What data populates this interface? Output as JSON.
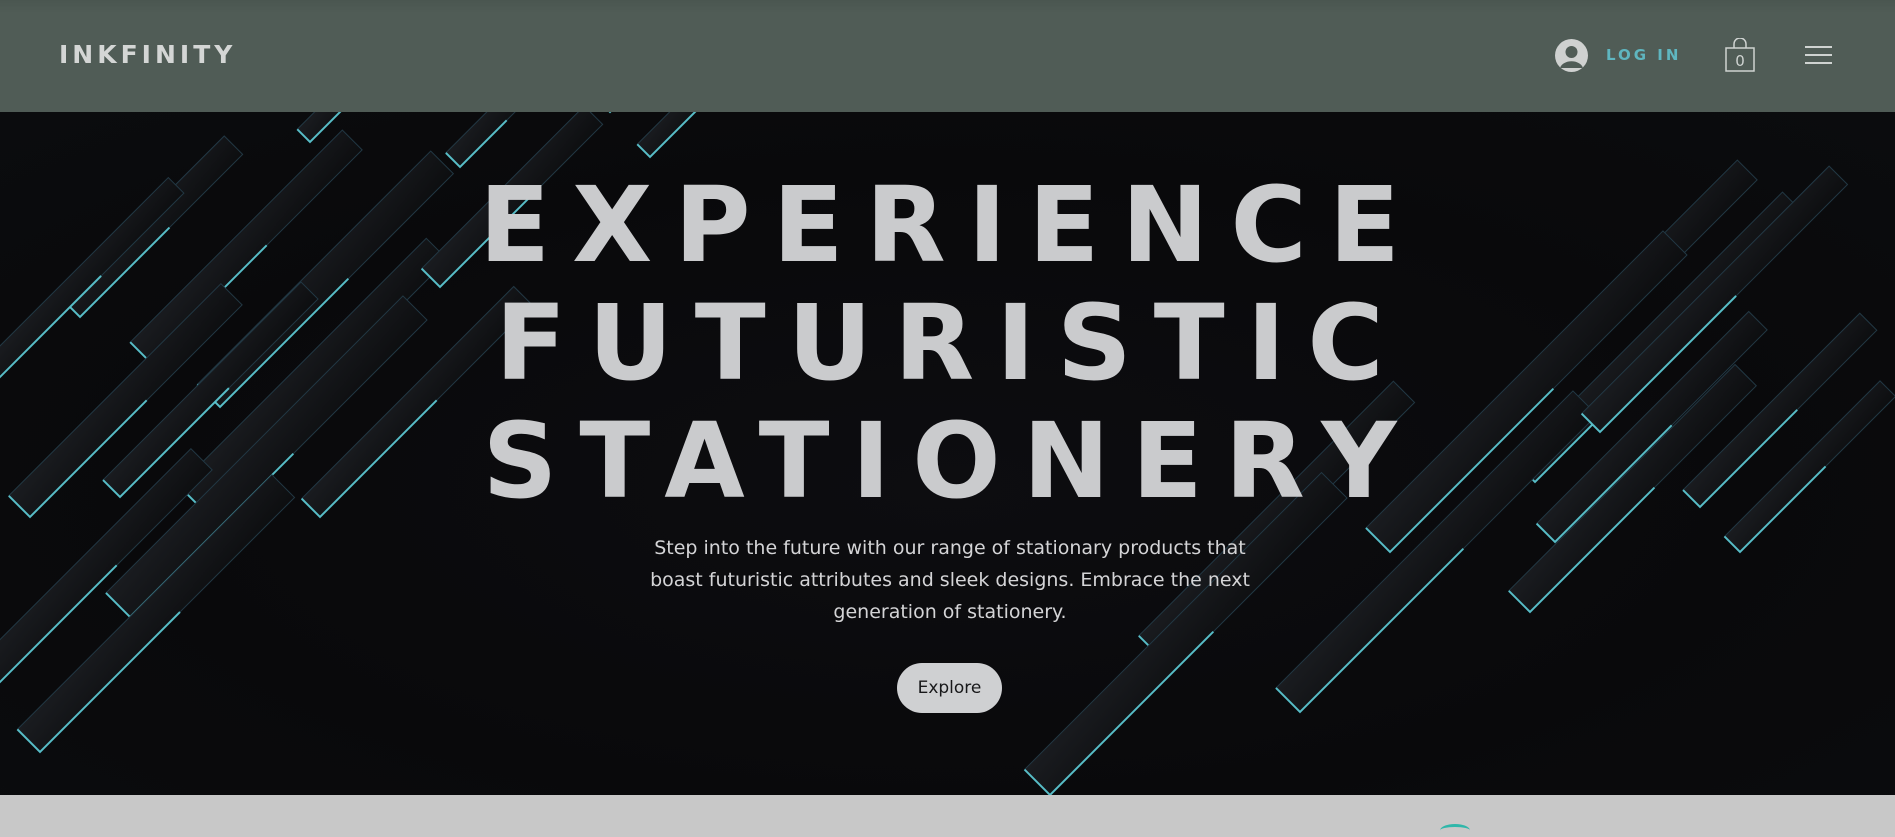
{
  "header": {
    "logo": "INKFINITY",
    "login_label": "LOG IN",
    "cart_count": "0",
    "colors": {
      "background": "#505c56",
      "accent": "#5fb6c0"
    },
    "icons": {
      "avatar": "user-avatar-icon",
      "cart": "shopping-bag-icon",
      "menu": "hamburger-menu-icon"
    }
  },
  "hero": {
    "headline": [
      "EXPERIENCE",
      "FUTURISTIC",
      "STATIONERY"
    ],
    "subtitle_lines": [
      "Step into the future with our range of stationary products that",
      "boast futuristic attributes and sleek designs. Embrace the next",
      "generation of stationery."
    ],
    "cta_label": "Explore",
    "colors": {
      "background": "#0a0a0c",
      "line_accent": "#62d6e0"
    }
  }
}
